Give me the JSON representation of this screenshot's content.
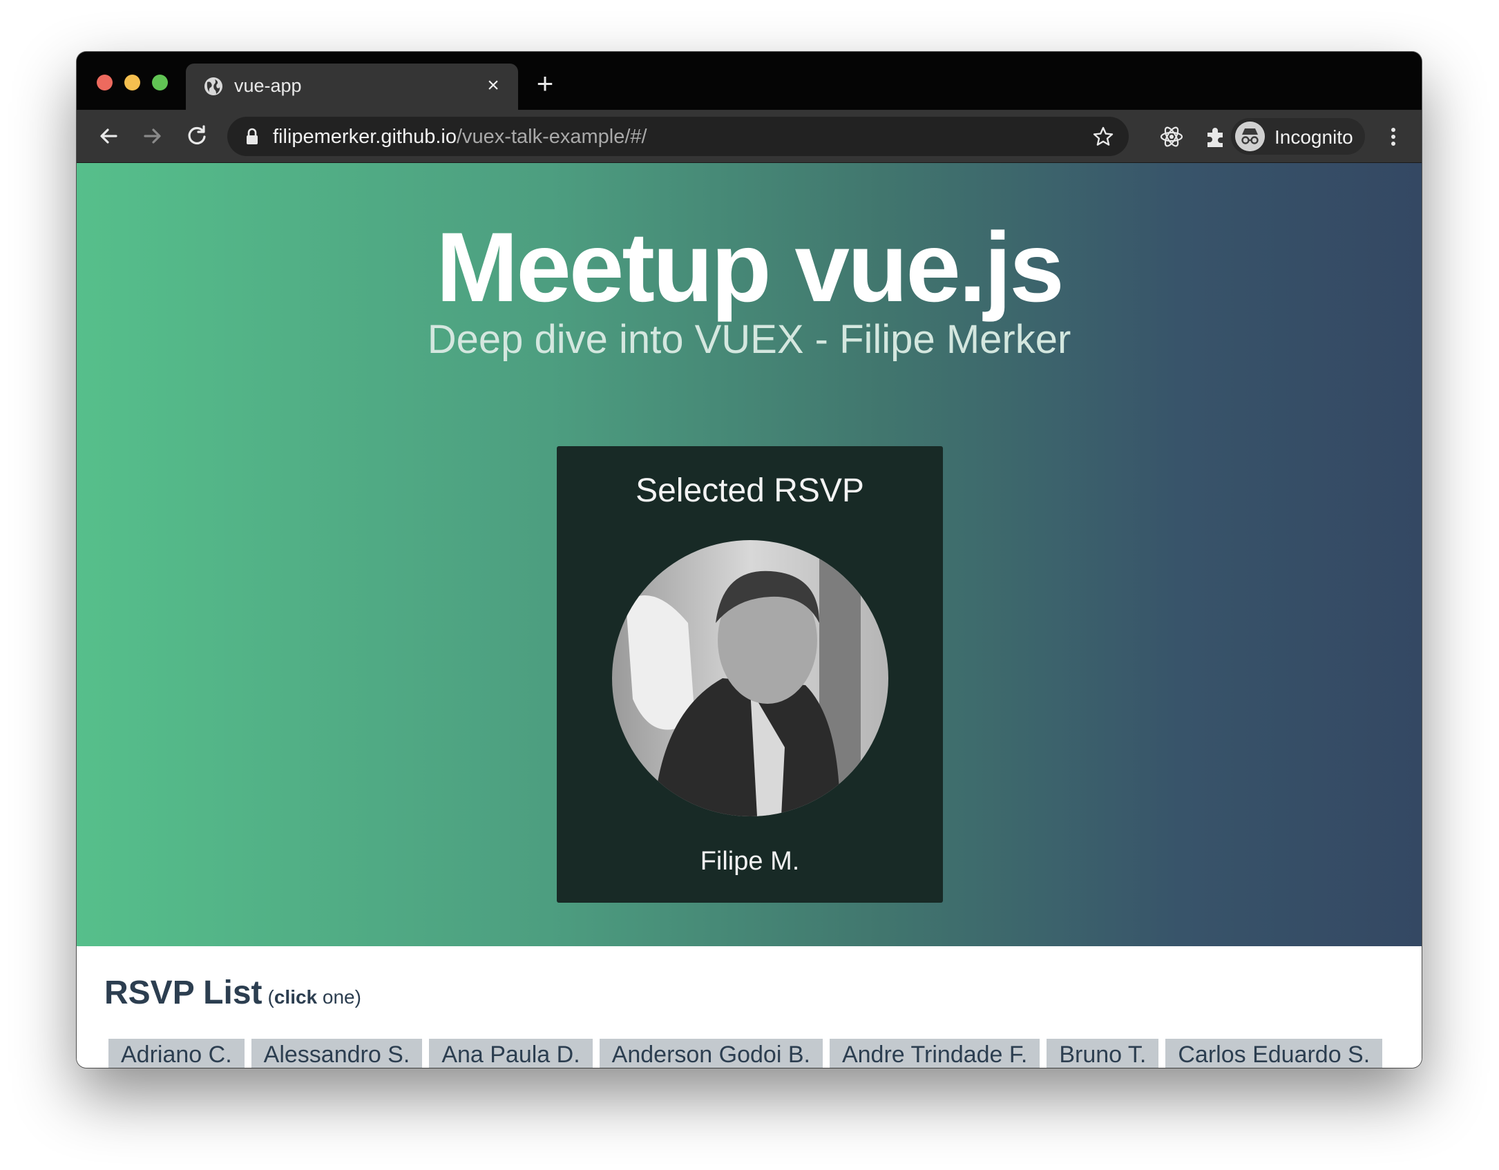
{
  "browser": {
    "tab_title": "vue-app",
    "tab_close_symbol": "×",
    "new_tab_symbol": "+",
    "url_host": "filipemerker.github.io",
    "url_path": "/vuex-talk-example/#/",
    "profile_label": "Incognito",
    "icons": [
      "globe-icon",
      "close-icon",
      "plus-icon",
      "back-icon",
      "forward-icon",
      "reload-icon",
      "lock-icon",
      "star-icon",
      "react-devtools-icon",
      "extensions-icon",
      "incognito-icon",
      "more-vert-icon"
    ]
  },
  "hero": {
    "title": "Meetup vue.js",
    "subtitle": "Deep dive into VUEX - Filipe Merker"
  },
  "selected_rsvp": {
    "title": "Selected RSVP",
    "name": "Filipe M."
  },
  "rsvp_list": {
    "heading": "RSVP List",
    "hint_open": "(",
    "hint_bold": "click",
    "hint_rest": " one)",
    "names": [
      "Adriano C.",
      "Alessandro S.",
      "Ana Paula D.",
      "Anderson Godoi B.",
      "Andre Trindade F.",
      "Bruno T.",
      "Carlos Eduardo S."
    ]
  },
  "colors": {
    "gradient_start": "#56bf8b",
    "gradient_end": "#344863",
    "card_bg": "#182a26",
    "heading_text": "#2c3e50",
    "chip_bg": "#c3c9ce"
  }
}
